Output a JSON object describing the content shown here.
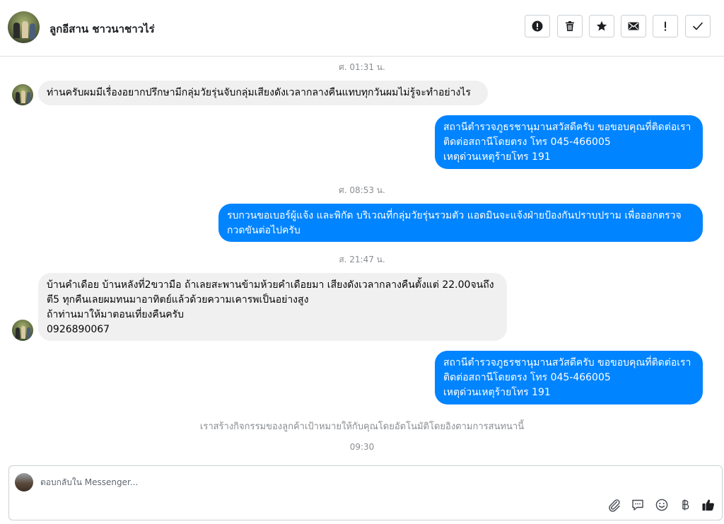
{
  "header": {
    "contact_name": "ลูกอีสาน ชาวนาชาวไร่",
    "actions": [
      {
        "name": "spam",
        "icon": "alert-circle-icon"
      },
      {
        "name": "delete",
        "icon": "trash-icon"
      },
      {
        "name": "star",
        "icon": "star-icon"
      },
      {
        "name": "mark-unread",
        "icon": "envelope-icon"
      },
      {
        "name": "follow-up",
        "icon": "exclamation-icon"
      },
      {
        "name": "done",
        "icon": "check-icon"
      }
    ]
  },
  "conversation": {
    "time_1": "ศ. 01:31 น.",
    "msg_1": "ท่านครับผมมีเรื่องอยากปรึกษามีกลุ่มวัยรุ่นจับกลุ่มเสียงดังเวลากลางคืนแทบทุกวันผมไม่รู้จะทำอย่างไร",
    "msg_2": "สถานีตำรวจภูธรชานุมานสวัสดีครับ ขอขอบคุณที่ติดต่อเรา\nติดต่อสถานีโดยตรง โทร 045-466005\nเหตุด่วนเหตุร้ายโทร 191",
    "time_2": "ศ. 08:53 น.",
    "msg_3": "รบกวนขอเบอร์ผู้แจ้ง และพิกัด บริเวณที่กลุ่มวัยรุ่นรวมตัว แอดมินจะแจ้งฝ่ายป้องกันปราบปราม เพื่อออกตรวจ\nกวดขันต่อไปครับ",
    "time_3": "ส. 21:47 น.",
    "msg_4": "บ้านคำเดือย บ้านหลังที่2ขวามือ ถ้าเลยสะพานข้ามห้วยคำเดือยมา เสียงดังเวลากลางคืนตั้งแต่ 22.00จนถึง\nตี5 ทุกคืนเลยผมทนมาอาทิตย์แล้วด้วยความเคารพเป็นอย่างสูง\nถ้าท่านมาให้มาตอนเที่ยงคืนครับ\n0926890067",
    "msg_5": "สถานีตำรวจภูธรชานุมานสวัสดีครับ ขอขอบคุณที่ติดต่อเรา\nติดต่อสถานีโดยตรง โทร 045-466005\nเหตุด่วนเหตุร้ายโทร 191",
    "auto_note": "เราสร้างกิจกรรมของลูกค้าเป้าหมายให้กับคุณโดยอัตโนมัติโดยอิงตามการสนทนานี้",
    "time_4": "09:30"
  },
  "composer": {
    "placeholder": "ตอบกลับใน Messenger...",
    "icons": [
      "paperclip-icon",
      "saved-reply-icon",
      "emoji-icon",
      "baht-icon",
      "thumbs-up-icon"
    ]
  },
  "colors": {
    "outgoing_bubble": "#0084ff",
    "incoming_bubble": "#f0f0f0",
    "muted_text": "#8a8d91"
  }
}
